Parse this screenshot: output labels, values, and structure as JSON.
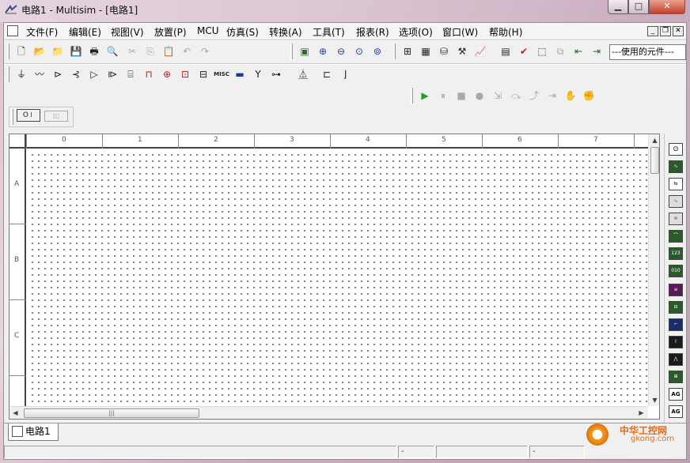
{
  "window": {
    "title": "电路1 - Multisim - [电路1]",
    "min_label": "▁",
    "max_label": "□",
    "close_label": "✕"
  },
  "menubar": {
    "items": [
      "文件(F)",
      "编辑(E)",
      "视图(V)",
      "放置(P)",
      "MCU",
      "仿真(S)",
      "转换(A)",
      "工具(T)",
      "报表(R)",
      "选项(O)",
      "窗口(W)",
      "帮助(H)"
    ],
    "mdi_min": "_",
    "mdi_restore": "❐",
    "mdi_close": "✕"
  },
  "toolbar_standard": {
    "buttons": [
      "new-icon",
      "open-icon",
      "open-folder-icon",
      "save-icon",
      "print-icon",
      "print-preview-icon",
      "cut-icon",
      "copy-icon",
      "paste-icon",
      "undo-icon",
      "redo-icon"
    ]
  },
  "toolbar_view": {
    "buttons": [
      "fullscreen-icon",
      "zoom-in-icon",
      "zoom-out-icon",
      "zoom-area-icon",
      "zoom-fit-icon"
    ]
  },
  "toolbar_main": {
    "buttons": [
      "design-toolbox-icon",
      "spreadsheet-icon",
      "database-icon",
      "component-wizard-icon",
      "grapher-icon",
      "postprocessor-icon",
      "erc-icon",
      "region-icon",
      "ultiboard-icon",
      "back-annotate-icon",
      "forward-annotate-icon"
    ],
    "in_use_list": "---使用的元件---"
  },
  "toolbar_components": {
    "buttons": [
      "source-icon",
      "basic-icon",
      "diode-icon",
      "transistor-icon",
      "analog-icon",
      "ttl-icon",
      "cmos-icon",
      "mcu-icon",
      "advanced-peripherals-icon",
      "misc-digital-icon",
      "mixed-icon",
      "indicator-icon",
      "power-icon",
      "misc-icon",
      "rf-icon",
      "electromech-icon",
      "place-hierarchical-icon",
      "place-bus-icon",
      "bus-icon"
    ],
    "misc_label": "MISC"
  },
  "toolbar_sim": {
    "buttons": [
      "run-icon",
      "pause-icon",
      "stop-icon",
      "breakpoint-icon",
      "step-into-icon",
      "step-over-icon",
      "step-out-icon",
      "run-to-cursor-icon",
      "toggle-breakpoint-icon",
      "remove-breakpoints-icon"
    ]
  },
  "toolbar_switch": {
    "buttons": [
      "sim-switch-icon",
      "sim-toggle-icon"
    ]
  },
  "ruler": {
    "columns": [
      "0",
      "1",
      "2",
      "3",
      "4",
      "5",
      "6",
      "7"
    ],
    "rows": [
      "A",
      "B",
      "C"
    ]
  },
  "instruments": {
    "items": [
      "multimeter-icon",
      "function-generator-icon",
      "wattmeter-icon",
      "oscilloscope-icon",
      "four-channel-oscilloscope-icon",
      "bode-plotter-icon",
      "frequency-counter-icon",
      "word-generator-icon",
      "logic-analyzer-icon",
      "logic-converter-icon",
      "iv-analyzer-icon",
      "distortion-analyzer-icon",
      "spectrum-analyzer-icon",
      "network-analyzer-icon",
      "agilent-function-generator-icon",
      "agilent-multimeter-icon"
    ],
    "agilent_label": "AG"
  },
  "tabs": {
    "active": "电路1"
  },
  "statusbar": {
    "cell1": "-",
    "cell2": "-"
  },
  "watermark": {
    "cn": "中华工控网",
    "url": "gkong.com"
  },
  "colors": {
    "sim_run": "#1ea01e",
    "sim_inactive": "#9a9a9a",
    "window_frame": "#d8c4cf",
    "watermark": "#e86a12"
  }
}
